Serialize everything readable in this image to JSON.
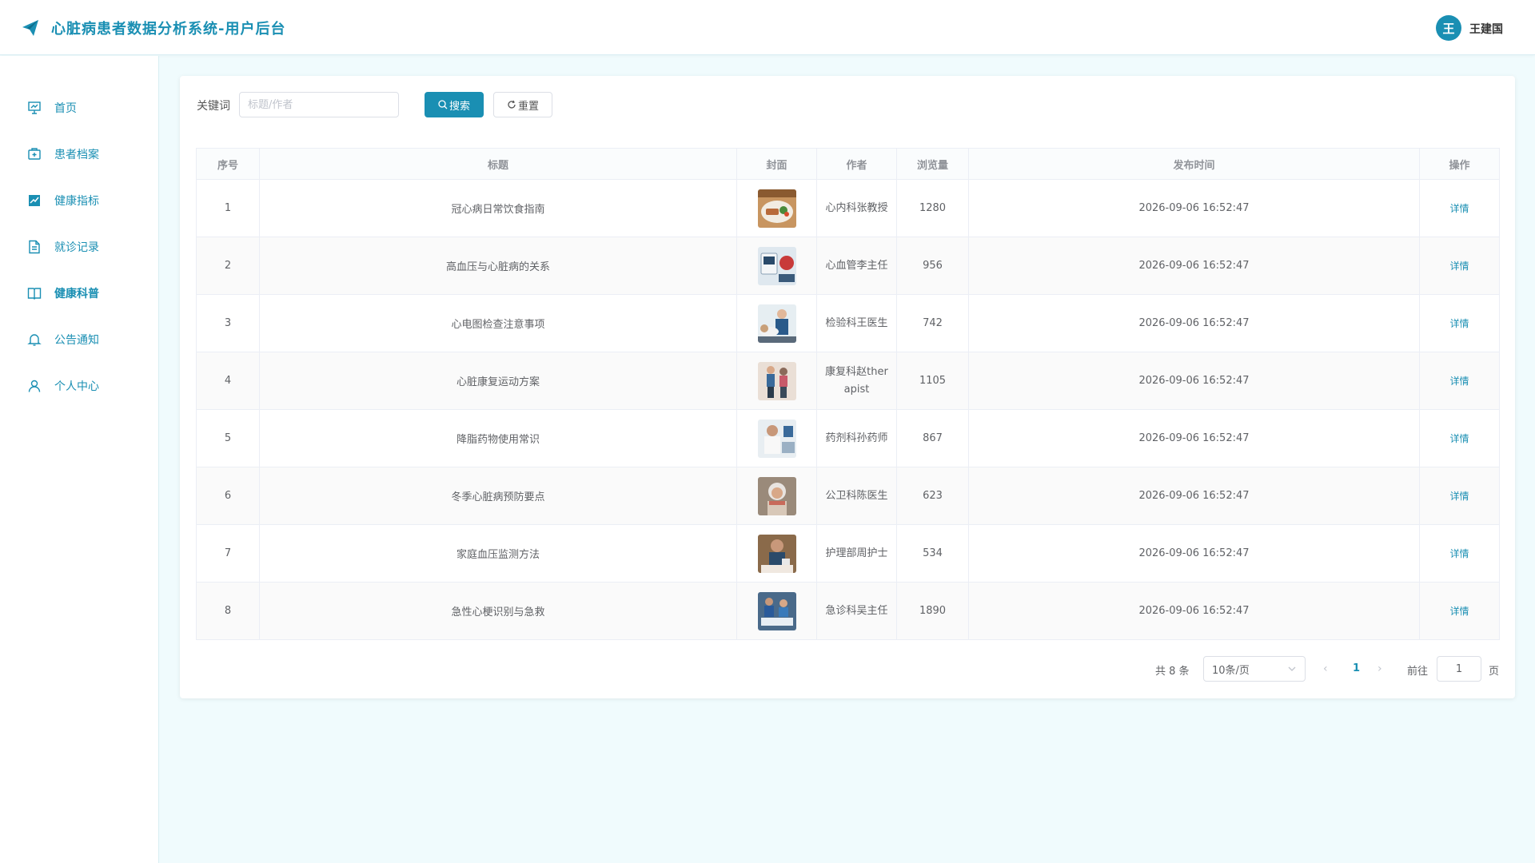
{
  "header": {
    "title": "心脏病患者数据分析系统-用户后台",
    "avatar_letter": "王",
    "user_name": "王建国",
    "brand_color": "#1a8fb3"
  },
  "sidebar": {
    "items": [
      {
        "label": "首页",
        "icon": "presentation-chart-icon"
      },
      {
        "label": "患者档案",
        "icon": "medical-kit-icon"
      },
      {
        "label": "健康指标",
        "icon": "trend-chart-icon"
      },
      {
        "label": "就诊记录",
        "icon": "document-icon"
      },
      {
        "label": "健康科普",
        "icon": "open-book-icon"
      },
      {
        "label": "公告通知",
        "icon": "bell-icon"
      },
      {
        "label": "个人中心",
        "icon": "user-icon"
      }
    ],
    "active_index": 4
  },
  "search": {
    "label": "关键词",
    "placeholder": "标题/作者",
    "value": "",
    "search_button": "搜索",
    "reset_button": "重置"
  },
  "table": {
    "headers": [
      "序号",
      "标题",
      "封面",
      "作者",
      "浏览量",
      "发布时间",
      "操作"
    ],
    "action_label": "详情",
    "rows": [
      {
        "index": "1",
        "title": "冠心病日常饮食指南",
        "author": "心内科张教授",
        "views": "1280",
        "time": "2026-09-06 16:52:47",
        "cover": "food-cover"
      },
      {
        "index": "2",
        "title": "高血压与心脏病的关系",
        "author": "心血管李主任",
        "views": "956",
        "time": "2026-09-06 16:52:47",
        "cover": "blood-pressure-cover"
      },
      {
        "index": "3",
        "title": "心电图检查注意事项",
        "author": "检验科王医生",
        "views": "742",
        "time": "2026-09-06 16:52:47",
        "cover": "ecg-cover"
      },
      {
        "index": "4",
        "title": "心脏康复运动方案",
        "author": "康复科赵therapist",
        "views": "1105",
        "time": "2026-09-06 16:52:47",
        "cover": "rehab-cover"
      },
      {
        "index": "5",
        "title": "降脂药物使用常识",
        "author": "药剂科孙药师",
        "views": "867",
        "time": "2026-09-06 16:52:47",
        "cover": "pharmacist-cover"
      },
      {
        "index": "6",
        "title": "冬季心脏病预防要点",
        "author": "公卫科陈医生",
        "views": "623",
        "time": "2026-09-06 16:52:47",
        "cover": "winter-cover"
      },
      {
        "index": "7",
        "title": "家庭血压监测方法",
        "author": "护理部周护士",
        "views": "534",
        "time": "2026-09-06 16:52:47",
        "cover": "home-bp-cover"
      },
      {
        "index": "8",
        "title": "急性心梗识别与急救",
        "author": "急诊科吴主任",
        "views": "1890",
        "time": "2026-09-06 16:52:47",
        "cover": "emergency-cover"
      }
    ]
  },
  "pagination": {
    "total": "共 8 条",
    "page_size": "10条/页",
    "current_page": "1",
    "goto_label": "前往",
    "goto_value": "1",
    "page_suffix": "页"
  }
}
